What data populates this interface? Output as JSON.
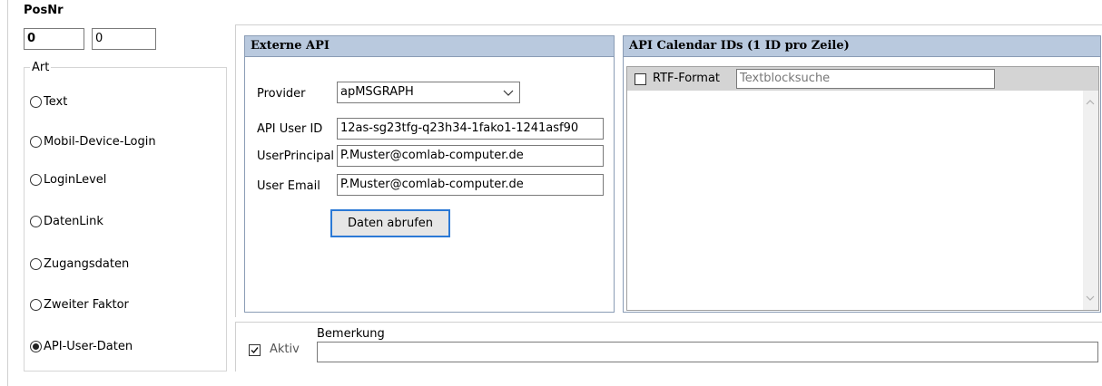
{
  "posnr": {
    "label": "PosNr",
    "value1": "0",
    "value2": "0"
  },
  "art": {
    "label": "Art",
    "options": [
      {
        "label": "Text",
        "checked": false
      },
      {
        "label": "Mobil-Device-Login",
        "checked": false
      },
      {
        "label": "LoginLevel",
        "checked": false
      },
      {
        "label": "DatenLink",
        "checked": false
      },
      {
        "label": "Zugangsdaten",
        "checked": false
      },
      {
        "label": "Zweiter Faktor",
        "checked": false
      },
      {
        "label": "API-User-Daten",
        "checked": true
      }
    ]
  },
  "externe_api": {
    "title": "Externe API",
    "provider_label": "Provider",
    "provider_value": "apMSGRAPH",
    "api_user_id_label": "API User ID",
    "api_user_id_value": "12as-sg23tfg-q23h34-1fako1-1241asf90",
    "user_principal_label": "UserPrincipal",
    "user_principal_value": "P.Muster@comlab-computer.de",
    "user_email_label": "User Email",
    "user_email_value": "P.Muster@comlab-computer.de",
    "fetch_button_label": "Daten abrufen"
  },
  "calendar": {
    "title": "API Calendar IDs (1 ID pro Zeile)",
    "rtf_label": "RTF-Format",
    "rtf_checked": false,
    "search_placeholder": "Textblocksuche"
  },
  "footer": {
    "aktiv_label": "Aktiv",
    "aktiv_checked": true,
    "bemerkung_label": "Bemerkung",
    "bemerkung_value": ""
  },
  "colors": {
    "panel_header_bg": "#b9c9de",
    "panel_border": "#8a9cb5",
    "button_border": "#2b79d6"
  }
}
